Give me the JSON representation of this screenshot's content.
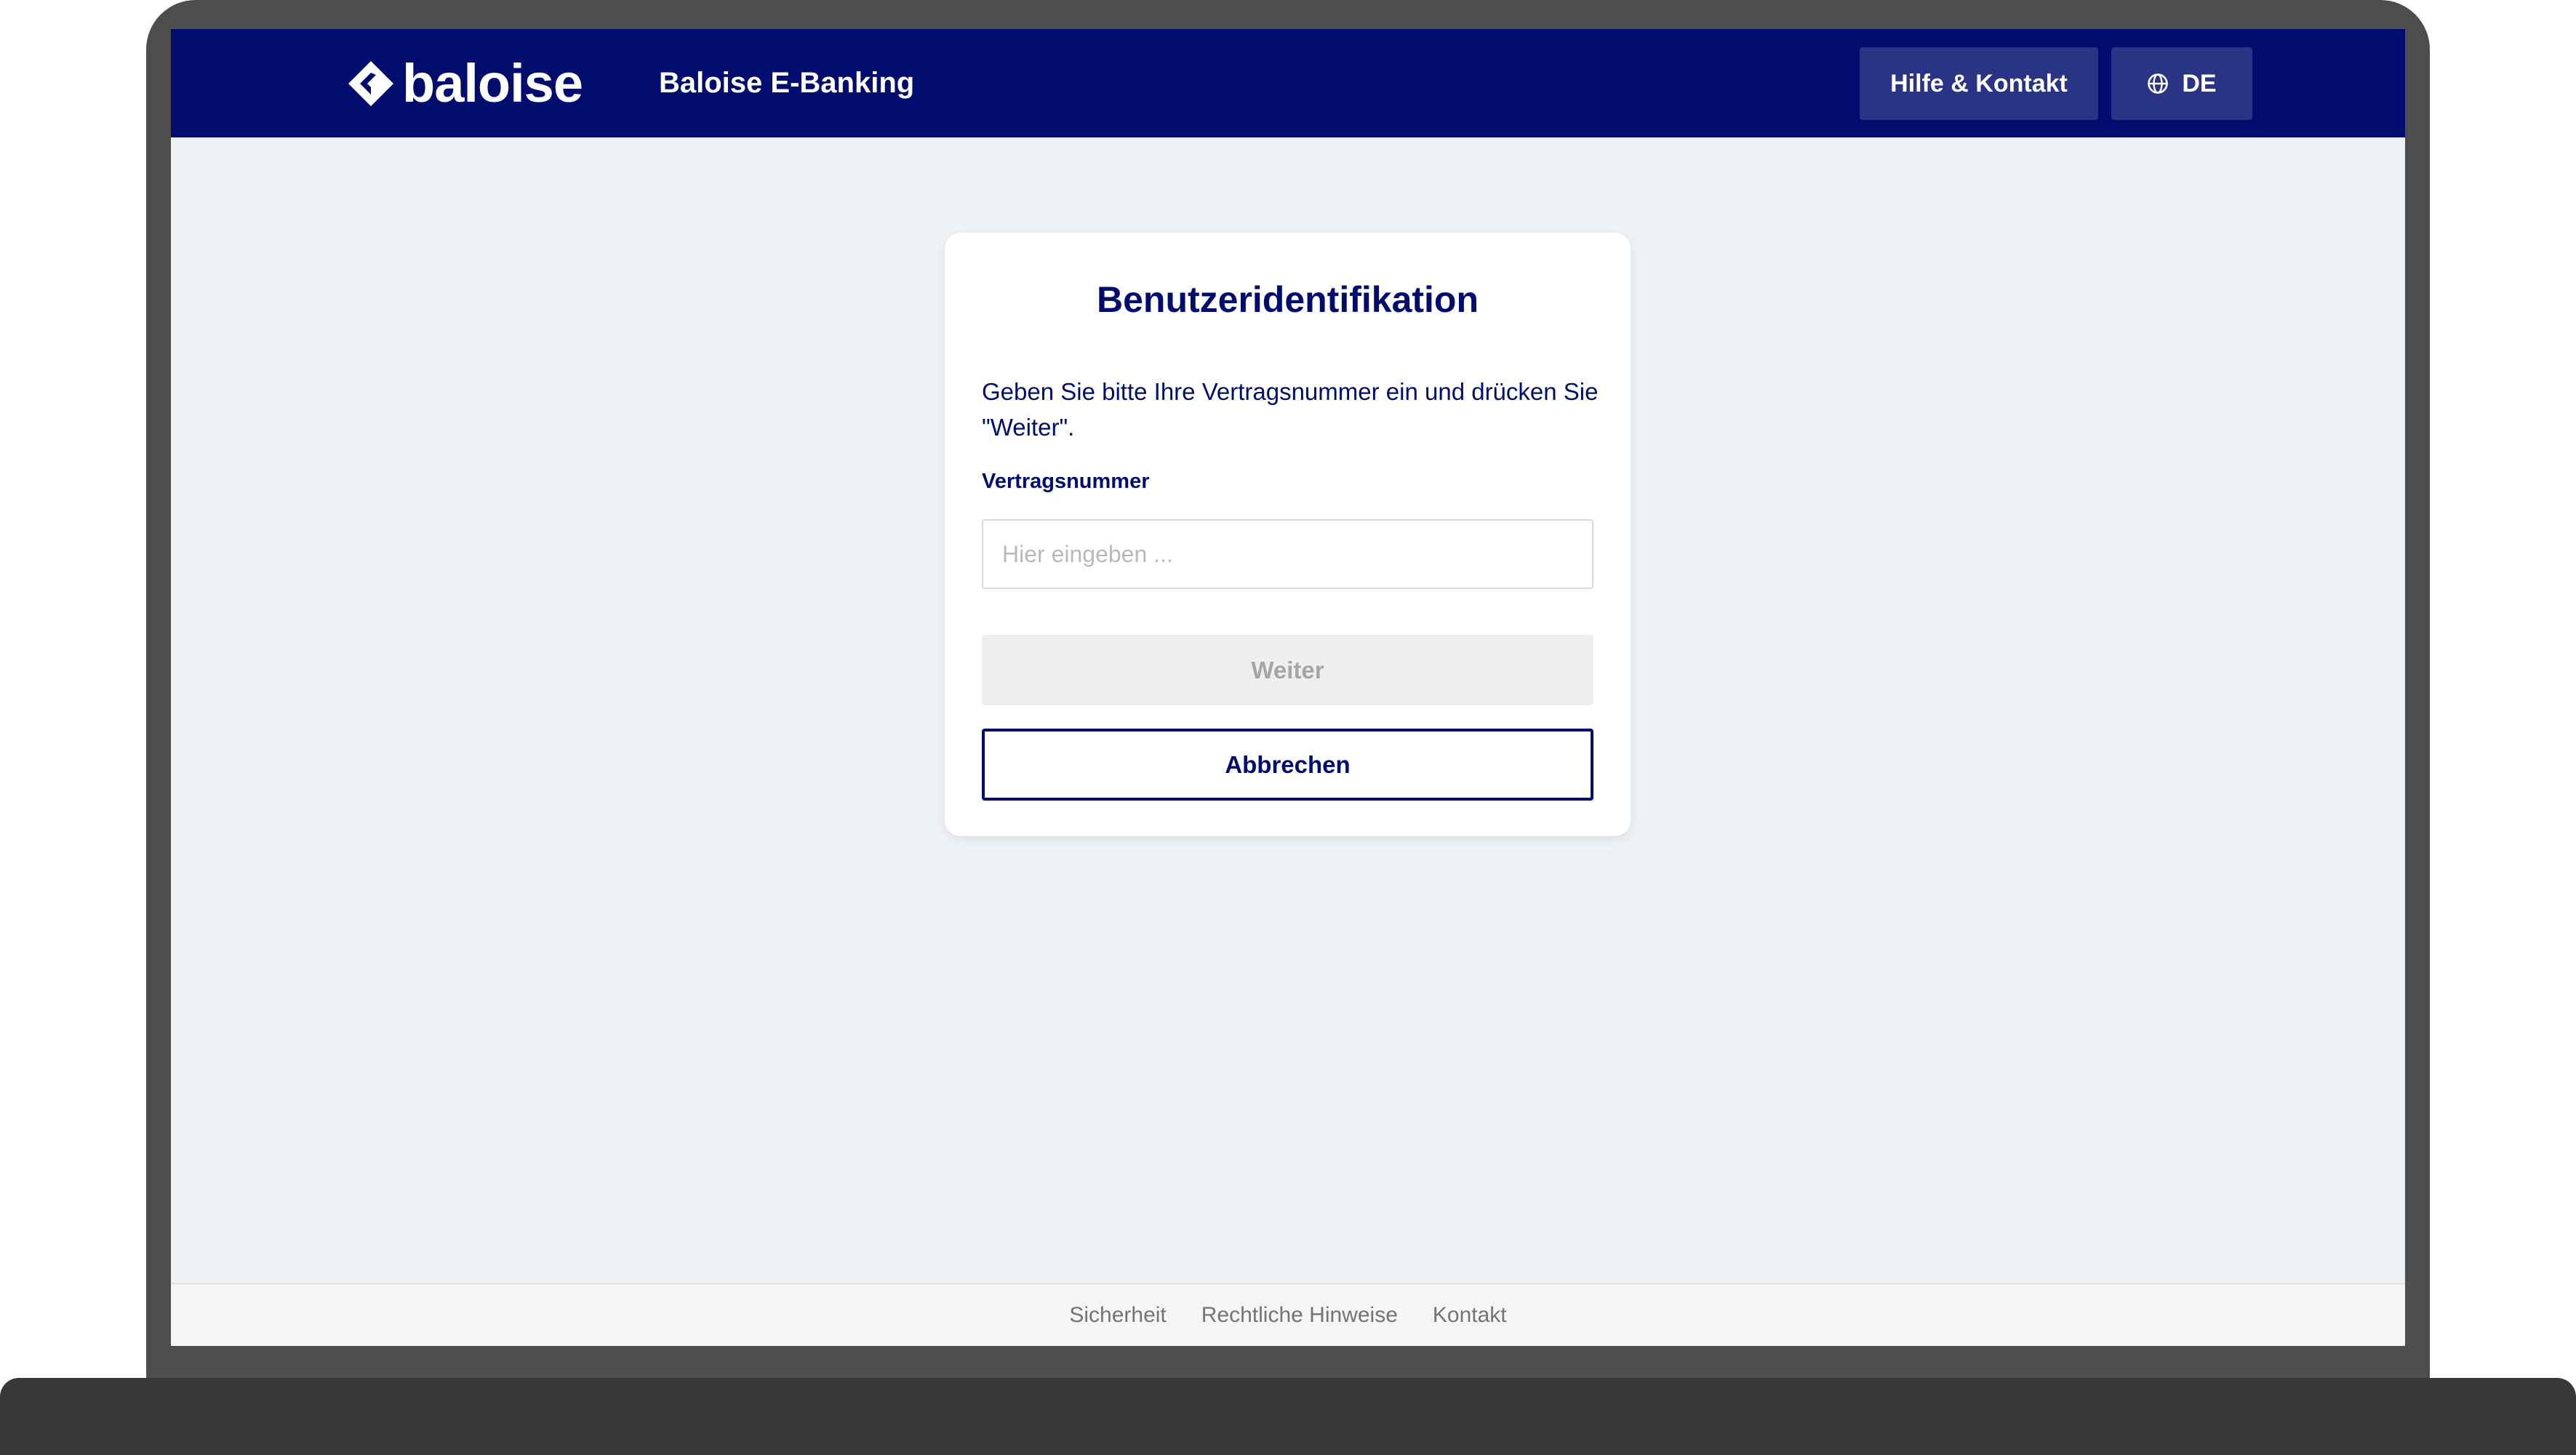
{
  "header": {
    "brand": "baloise",
    "app_title": "Baloise E-Banking",
    "help_button": "Hilfe & Kontakt",
    "language_button": "DE"
  },
  "login": {
    "title": "Benutzeridentifikation",
    "description": "Geben Sie bitte Ihre Vertragsnummer ein und drücken Sie \"Weiter\".",
    "field_label": "Vertragsnummer",
    "field_value": "",
    "field_placeholder": "Hier eingeben ...",
    "next_button": "Weiter",
    "cancel_button": "Abbrechen"
  },
  "footer": {
    "links": [
      "Sicherheit",
      "Rechtliche Hinweise",
      "Kontakt"
    ]
  },
  "colors": {
    "brand_navy": "#000d6e",
    "header_button_bg": "#293485",
    "page_bg": "#eff2f5",
    "disabled_button_bg": "#efefef"
  },
  "icons": {
    "logo": "baloise-diamond-logo-icon",
    "language": "globe-icon"
  }
}
